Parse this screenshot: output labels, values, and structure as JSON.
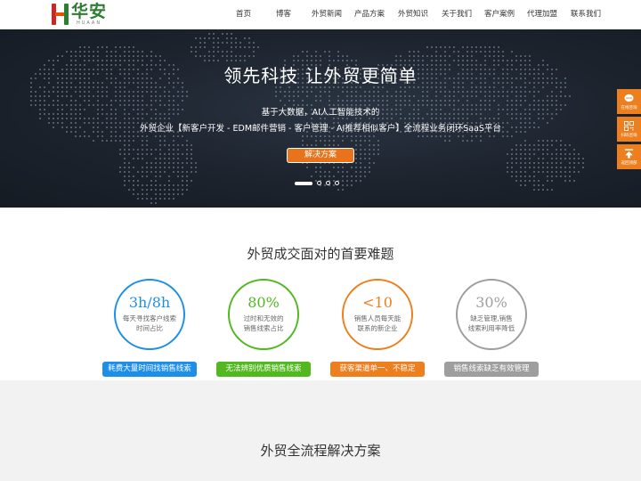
{
  "header": {
    "logo_cn": "华安",
    "logo_en": "HUAAN",
    "nav": [
      "首页",
      "博客",
      "外贸新闻",
      "产品方案",
      "外贸知识",
      "关于我们",
      "客户案例",
      "代理加盟",
      "联系我们"
    ]
  },
  "banner": {
    "title": "领先科技 让外贸更简单",
    "sub1": "基于大数据，AI人工智能技术的",
    "sub2": "外贸企业【新客户开发 - EDM邮件营销 - 客户管理 - AI推荐相似客户】全流程业务闭环SaaS平台",
    "button": "解决方案",
    "slide_count": 4,
    "active_slide": 1
  },
  "side": {
    "items": [
      {
        "label": "在线咨询",
        "icon": "chat-icon"
      },
      {
        "label": "扫码咨询",
        "icon": "qrcode-icon"
      },
      {
        "label": "返回顶部",
        "icon": "arrow-up-icon"
      }
    ]
  },
  "problems": {
    "title": "外贸成交面对的首要难题",
    "items": [
      {
        "big": "3h/8h",
        "line1": "每天寻找客户线索",
        "line2": "时间占比",
        "tag": "耗费大量时间找销售线索",
        "color": "#1e8fe8"
      },
      {
        "big": "80%",
        "line1": "过时和无效的",
        "line2": "销售线索占比",
        "tag": "无法辨别优质销售线索",
        "color": "#52b81f"
      },
      {
        "big": "<10",
        "line1": "销售人员每天能",
        "line2": "联系的新企业",
        "tag": "获客渠道单一、不稳定",
        "color": "#ee7f1f"
      },
      {
        "big": "30%",
        "line1": "缺乏管理,销售",
        "line2": "线索利用率降低",
        "tag": "销售线索缺乏有效管理",
        "color": "#9e9e9e"
      }
    ]
  },
  "solutions": {
    "title": "外贸全流程解决方案"
  }
}
